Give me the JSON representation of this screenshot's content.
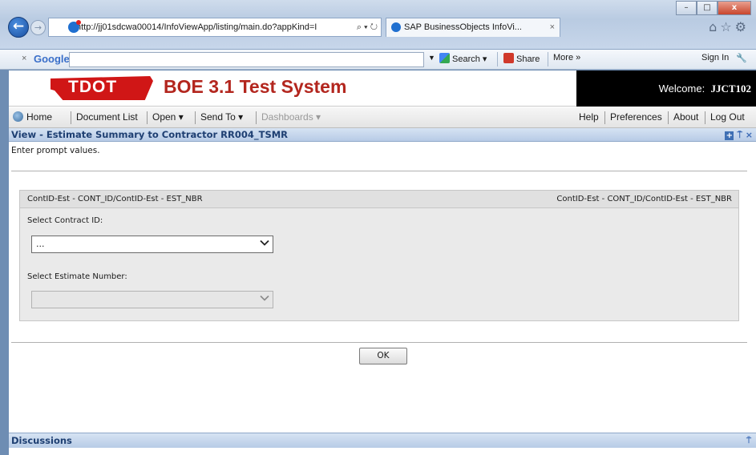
{
  "browser": {
    "url": "http://jj01sdcwa00014/InfoViewApp/listing/main.do?appKind=I",
    "tab_title": "SAP BusinessObjects InfoVi...",
    "tab_close": "×",
    "window_buttons": [
      "–",
      "□",
      "x"
    ]
  },
  "google_toolbar": {
    "close": "×",
    "logo": "Google",
    "search_label": "Search",
    "share_label": "Share",
    "more_label": "More »",
    "signin_label": "Sign In"
  },
  "app": {
    "logo_text": "TDOT",
    "title": "BOE 3.1 Test System",
    "welcome_label": "Welcome:",
    "username": "JJCT102"
  },
  "menu": {
    "home": "Home",
    "document_list": "Document List",
    "open": "Open ▾",
    "send_to": "Send To ▾",
    "dashboards": "Dashboards ▾",
    "help": "Help",
    "preferences": "Preferences",
    "about": "About",
    "log_out": "Log Out"
  },
  "panel": {
    "title": "View - Estimate Summary to Contractor RR004_TSMR",
    "prompt_message": "Enter prompt values."
  },
  "prompts": {
    "header_left": "ContID-Est - CONT_ID/ContID-Est - EST_NBR",
    "header_right": "ContID-Est - CONT_ID/ContID-Est - EST_NBR",
    "contract_label": "Select Contract ID:",
    "contract_value": "...",
    "estimate_label": "Select Estimate Number:",
    "estimate_value": ""
  },
  "buttons": {
    "ok": "OK"
  },
  "footer": {
    "discussions": "Discussions"
  },
  "colors": {
    "accent_red": "#b3261e",
    "panel_title_text": "#1e3f72"
  }
}
